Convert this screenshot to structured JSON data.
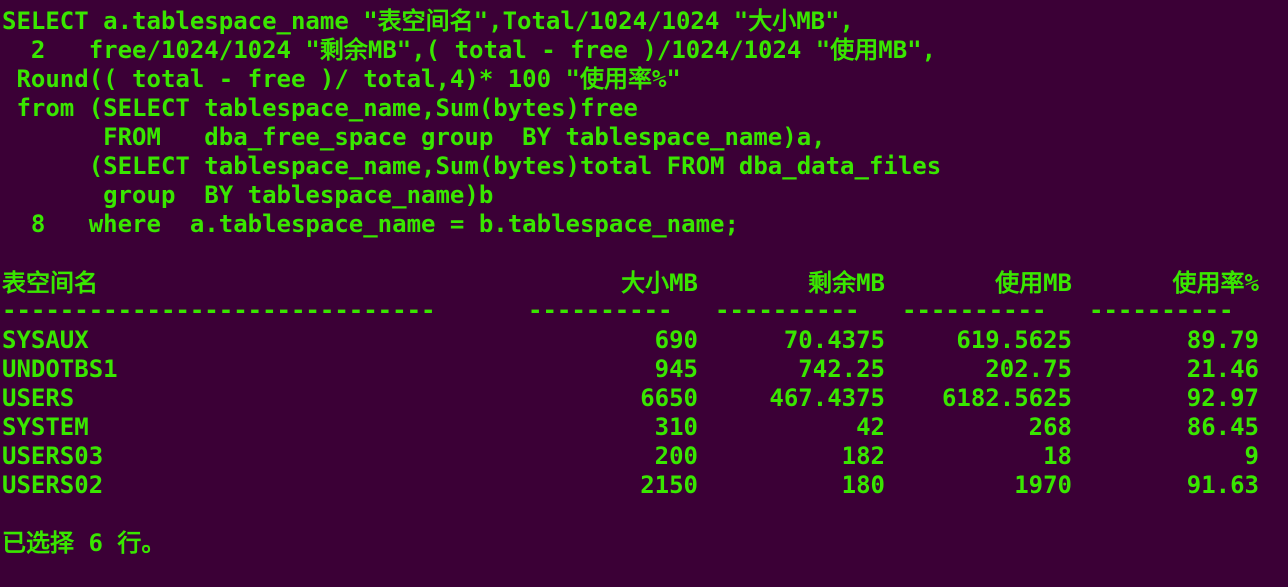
{
  "terminal": {
    "background": "#3b0036",
    "foreground": "#39e600",
    "sql_lines": [
      "SELECT a.tablespace_name \"表空间名\",Total/1024/1024 \"大小MB\",",
      "  2   free/1024/1024 \"剩余MB\",( total - free )/1024/1024 \"使用MB\",",
      " Round(( total - free )/ total,4)* 100 \"使用率%\"",
      " from (SELECT tablespace_name,Sum(bytes)free",
      "       FROM   dba_free_space group  BY tablespace_name)a,",
      "      (SELECT tablespace_name,Sum(bytes)total FROM dba_data_files",
      "       group  BY tablespace_name)b",
      "  8   where  a.tablespace_name = b.tablespace_name;"
    ],
    "result": {
      "headers": [
        "表空间名",
        "大小MB",
        "剩余MB",
        "使用MB",
        "使用率%"
      ],
      "separators": [
        "------------------------------",
        "----------",
        "----------",
        "----------",
        "----------"
      ],
      "rows": [
        [
          "SYSAUX",
          "690",
          "70.4375",
          "619.5625",
          "89.79"
        ],
        [
          "UNDOTBS1",
          "945",
          "742.25",
          "202.75",
          "21.46"
        ],
        [
          "USERS",
          "6650",
          "467.4375",
          "6182.5625",
          "92.97"
        ],
        [
          "SYSTEM",
          "310",
          "42",
          "268",
          "86.45"
        ],
        [
          "USERS03",
          "200",
          "182",
          "18",
          "9"
        ],
        [
          "USERS02",
          "2150",
          "180",
          "1970",
          "91.63"
        ]
      ]
    },
    "footer": "已选择 6 行。"
  }
}
